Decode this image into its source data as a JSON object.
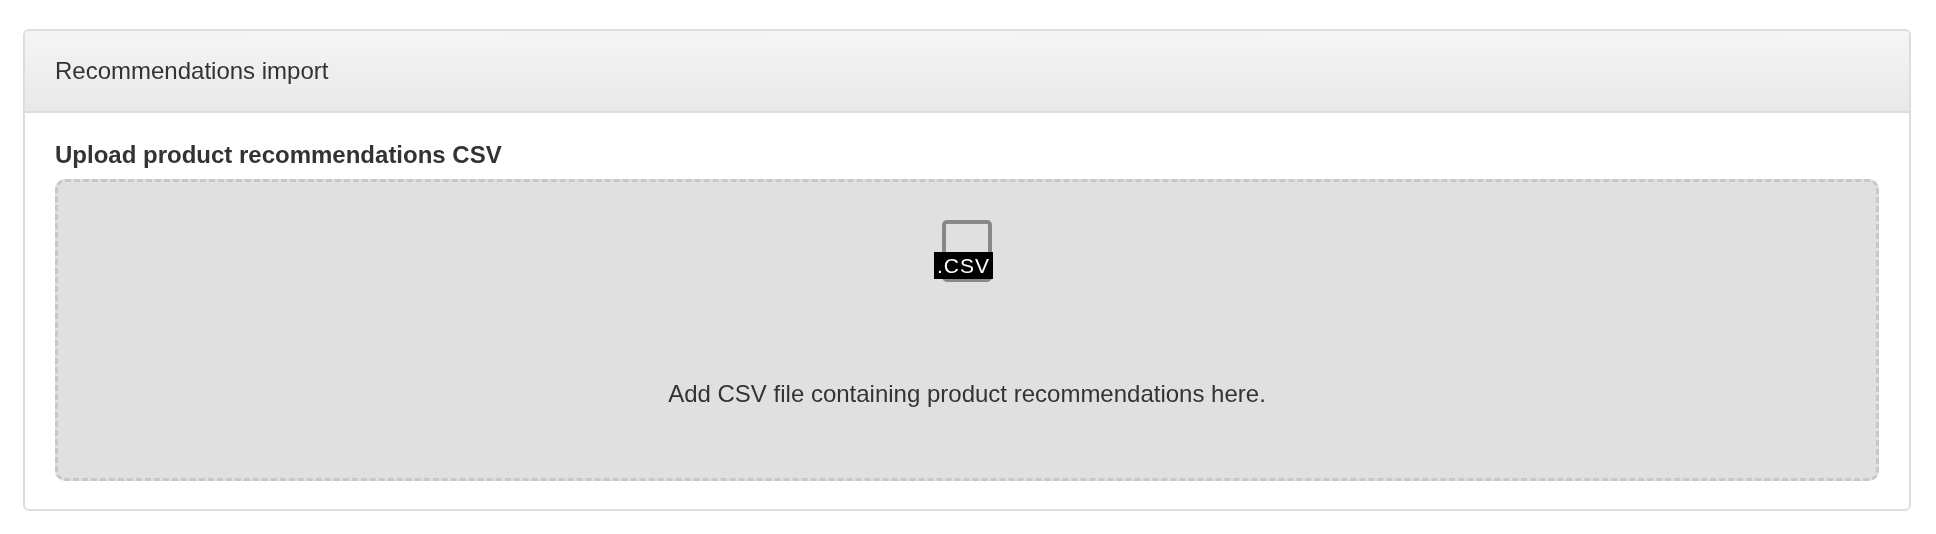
{
  "panel": {
    "title": "Recommendations import"
  },
  "upload": {
    "label": "Upload product recommendations CSV",
    "file_type": ".CSV",
    "message": "Add CSV file containing product recommendations here."
  }
}
